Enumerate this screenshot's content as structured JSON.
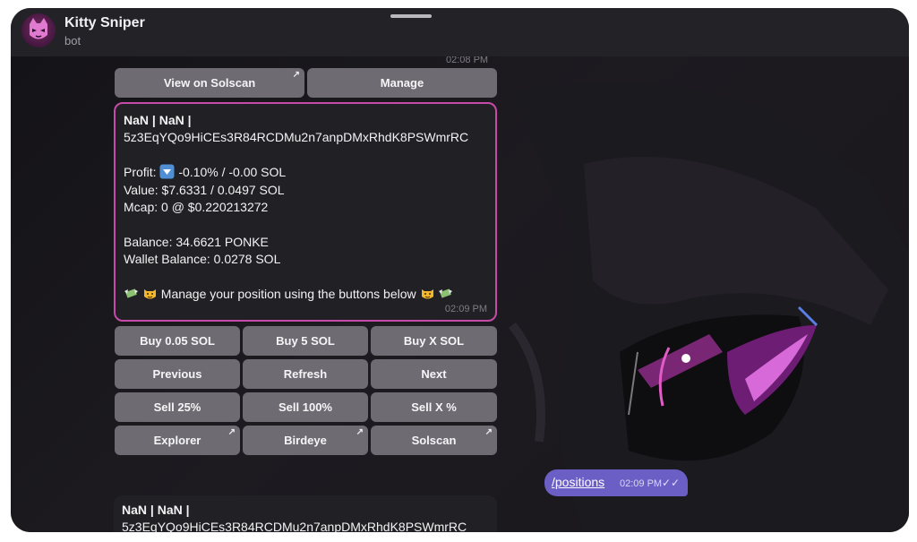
{
  "header": {
    "title": "Kitty Sniper",
    "subtitle": "bot"
  },
  "top_partial_time": "02:08 PM",
  "top_buttons": [
    {
      "label": "View on Solscan",
      "external": true
    },
    {
      "label": "Manage",
      "external": false
    }
  ],
  "position_message": {
    "lines": [
      "NaN | NaN |",
      "5z3EqYQo9HiCEs3R84RCDMu2n7anpDMxRhdK8PSWmrRC",
      "",
      "Profit:",
      "Value: $7.6331 / 0.0497 SOL",
      "Mcap: 0 @ $0.220213272",
      "",
      "Balance: 34.6621 PONKE",
      "Wallet Balance: 0.0278 SOL",
      "",
      "Manage your position using the buttons below"
    ],
    "profit_value": "-0.10% / -0.00 SOL",
    "time": "02:09 PM"
  },
  "keyboard": [
    [
      {
        "label": "Buy 0.05 SOL",
        "external": false
      },
      {
        "label": "Buy 5 SOL",
        "external": false
      },
      {
        "label": "Buy X SOL",
        "external": false
      }
    ],
    [
      {
        "label": "Previous",
        "external": false
      },
      {
        "label": "Refresh",
        "external": false
      },
      {
        "label": "Next",
        "external": false
      }
    ],
    [
      {
        "label": "Sell 25%",
        "external": false
      },
      {
        "label": "Sell 100%",
        "external": false
      },
      {
        "label": "Sell X %",
        "external": false
      }
    ],
    [
      {
        "label": "Explorer",
        "external": true
      },
      {
        "label": "Birdeye",
        "external": true
      },
      {
        "label": "Solscan",
        "external": true
      }
    ]
  ],
  "outgoing": {
    "text": "/positions",
    "time": "02:09 PM"
  },
  "bottom_message": {
    "lines": [
      "NaN | NaN |",
      "5z3EqYQo9HiCEs3R84RCDMu2n7anpDMxRhdK8PSWmrRC"
    ]
  },
  "icons": {
    "external": "arrow-up-right-icon",
    "read": "double-check-icon",
    "profit": "down-arrow-box-icon"
  },
  "colors": {
    "accent": "#c64ba8",
    "button": "#6e6c72",
    "outgoing": "#6b5fc6",
    "bubble": "#212024"
  }
}
